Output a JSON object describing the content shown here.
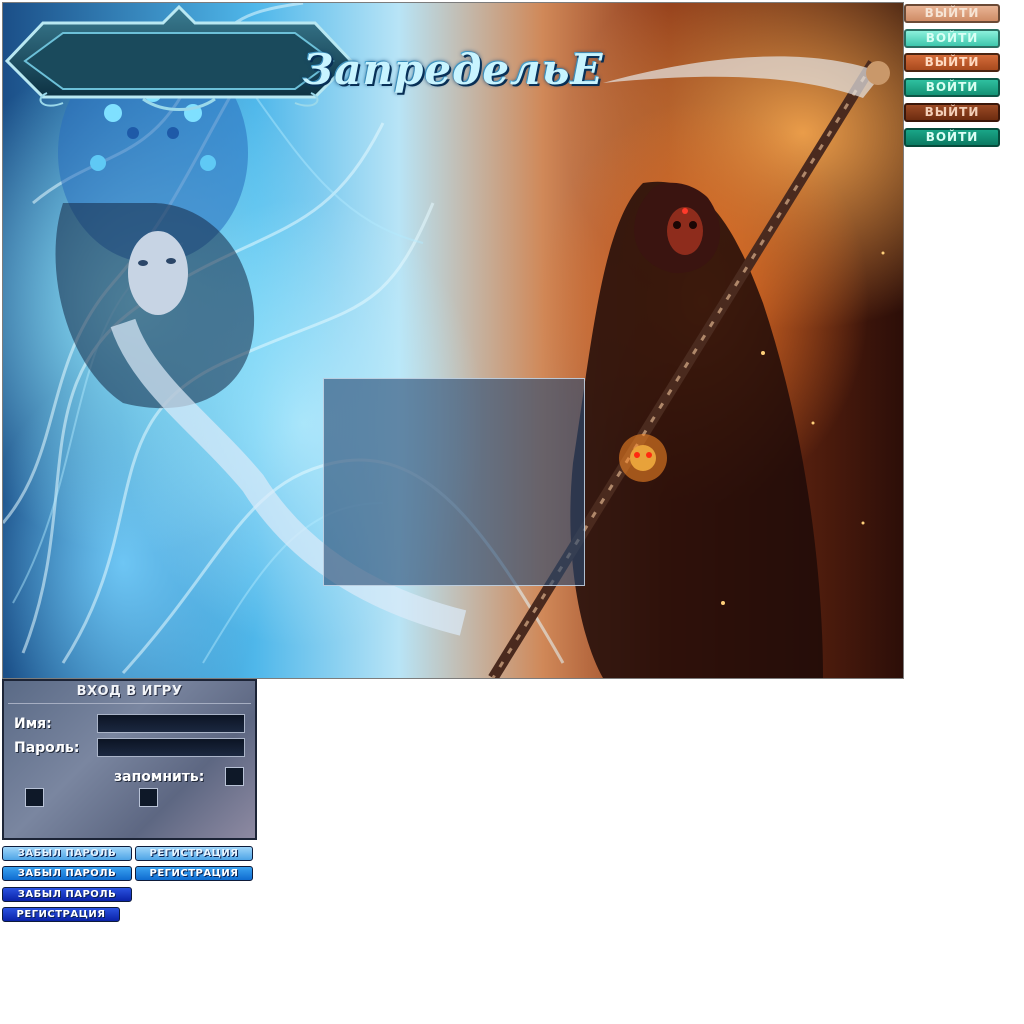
{
  "logo": {
    "text": "ЗапредельЕ"
  },
  "side_buttons": [
    {
      "label": "ВЫЙТИ"
    },
    {
      "label": "ВОЙТИ"
    },
    {
      "label": "ВЫЙТИ"
    },
    {
      "label": "ВОЙТИ"
    },
    {
      "label": "ВЫЙТИ"
    },
    {
      "label": "ВОЙТИ"
    }
  ],
  "login": {
    "title": "ВХОД В ИГРУ",
    "name_label": "Имя:",
    "password_label": "Пароль:",
    "remember_label": "запомнить:",
    "name_value": "",
    "password_value": ""
  },
  "links": [
    {
      "label": "ЗАБЫЛ ПАРОЛЬ"
    },
    {
      "label": "РЕГИСТРАЦИЯ"
    },
    {
      "label": "ЗАБЫЛ ПАРОЛЬ"
    },
    {
      "label": "РЕГИСТРАЦИЯ"
    },
    {
      "label": "ЗАБЫЛ ПАРОЛЬ"
    },
    {
      "label": "РЕГИСТРАЦИЯ"
    }
  ],
  "colors": {
    "ice_blue": "#4fb7ea",
    "fire_orange": "#d08858",
    "panel": "#5a6a86",
    "link_blue": "#0f6cd0"
  }
}
